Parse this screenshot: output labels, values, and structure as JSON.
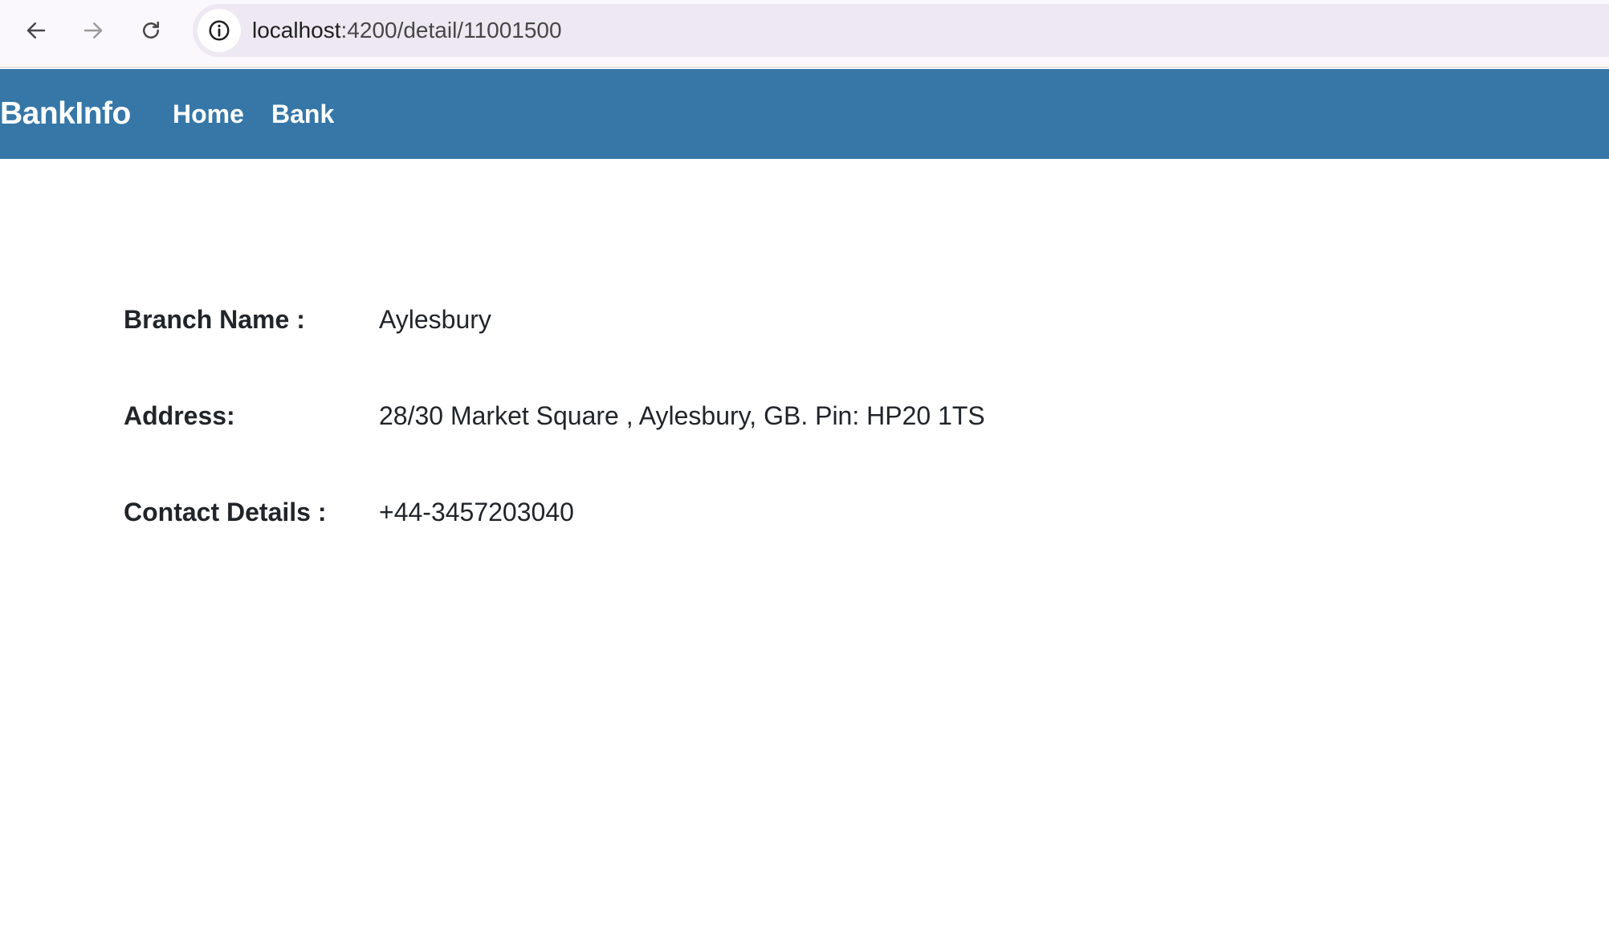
{
  "browser": {
    "url_host": "localhost",
    "url_path": ":4200/detail/11001500",
    "back_icon": "arrow-left-icon",
    "forward_icon": "arrow-right-icon",
    "reload_icon": "reload-icon",
    "site_info_icon": "info-icon"
  },
  "navbar": {
    "brand": "BankInfo",
    "links": [
      "Home",
      "Bank"
    ],
    "background_color": "#3677a8"
  },
  "detail": {
    "branch_name_label": "Branch Name :",
    "branch_name_value": "Aylesbury",
    "address_label": "Address:",
    "address_value": "28/30 Market Square , Aylesbury, GB. Pin: HP20 1TS",
    "contact_label": "Contact Details :",
    "contact_value": "+44-3457203040"
  }
}
